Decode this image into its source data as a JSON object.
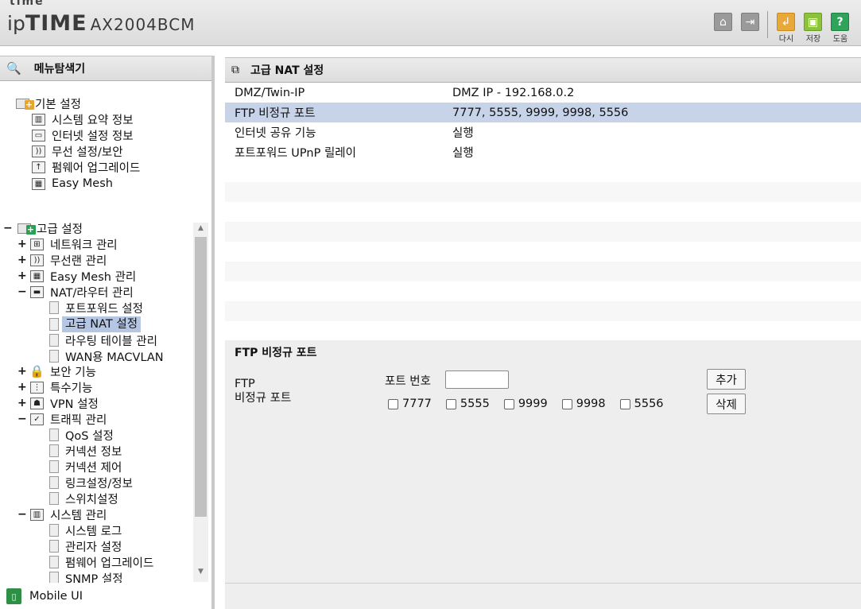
{
  "header": {
    "logo_top": "time",
    "logo_ip": "ip",
    "logo_time": "TIME",
    "model": "AX2004BCM",
    "buttons": [
      {
        "name": "home-icon",
        "label": ""
      },
      {
        "name": "logout-icon",
        "label": ""
      },
      {
        "name": "reload-icon",
        "label": "다시"
      },
      {
        "name": "save-icon",
        "label": "저장"
      },
      {
        "name": "help-icon",
        "label": "도움"
      }
    ]
  },
  "nav": {
    "title": "메뉴탐색기",
    "basic": {
      "label": "기본 설정",
      "items": [
        "시스템 요약 정보",
        "인터넷 설정 정보",
        "무선 설정/보안",
        "펌웨어 업그레이드",
        "Easy Mesh"
      ]
    },
    "advanced": {
      "label": "고급 설정",
      "network": "네트워크 관리",
      "wireless": "무선랜 관리",
      "easymesh": "Easy Mesh 관리",
      "nat": "NAT/라우터 관리",
      "nat_children": [
        "포트포워드 설정",
        "고급 NAT 설정",
        "라우팅 테이블 관리",
        "WAN용 MACVLAN"
      ],
      "security": "보안 기능",
      "special": "특수기능",
      "vpn": "VPN 설정",
      "traffic": "트래픽 관리",
      "traffic_children": [
        "QoS 설정",
        "커넥션 정보",
        "커넥션 제어",
        "링크설정/정보",
        "스위치설정"
      ],
      "system": "시스템 관리",
      "system_children": [
        "시스템 로그",
        "관리자 설정",
        "펌웨어 업그레이드",
        "SNMP 설정"
      ]
    },
    "mobile": "Mobile UI"
  },
  "main": {
    "title": "고급 NAT 설정",
    "rows": [
      {
        "key": "DMZ/Twin-IP",
        "value": "DMZ IP - 192.168.0.2"
      },
      {
        "key": "FTP 비정규 포트",
        "value": "7777, 5555, 9999, 9998, 5556"
      },
      {
        "key": "인터넷 공유 기능",
        "value": "실행"
      },
      {
        "key": "포트포워드 UPnP 릴레이",
        "value": "실행"
      }
    ],
    "ftp": {
      "section_title": "FTP 비정규 포트",
      "label_line1": "FTP",
      "label_line2": "비정규 포트",
      "port_label": "포트 번호",
      "port_value": "",
      "ports": [
        "7777",
        "5555",
        "9999",
        "9998",
        "5556"
      ],
      "add_label": "추가",
      "delete_label": "삭제"
    }
  }
}
